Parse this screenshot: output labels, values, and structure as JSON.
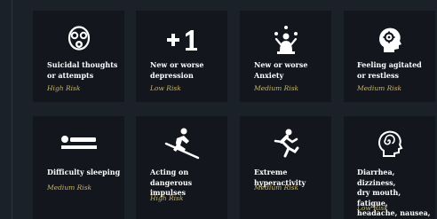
{
  "cards": [
    {
      "title": "Suicidal thoughts\nor attempts",
      "risk": "High Risk",
      "icon": "gas-mask-icon"
    },
    {
      "title": "New or worse\ndepression",
      "risk": "Low Risk",
      "icon": "plus-one-icon"
    },
    {
      "title": "New or worse\nAnxiety",
      "risk": "Medium Risk",
      "icon": "juggling-person-icon"
    },
    {
      "title": "Feeling agitated\nor restless",
      "risk": "Medium Risk",
      "icon": "head-gears-icon"
    },
    {
      "title": "Difficulty sleeping",
      "risk": "Medium Risk",
      "icon": "lying-person-icon"
    },
    {
      "title": "Acting on dangerous\nimpulses",
      "risk": "High Risk",
      "icon": "skier-icon"
    },
    {
      "title": "Extreme\nhyperactivity",
      "risk": "Medium Risk",
      "icon": "running-person-icon"
    },
    {
      "title": "Diarrhea, dizziness,\ndry mouth, fatigue,\nheadache, nausea,",
      "risk": "Low Risk",
      "icon": "dizzy-head-icon"
    }
  ],
  "colors": {
    "background": "#1b2129",
    "card": "#13171d",
    "title": "#ffffff",
    "risk": "#c8b36a"
  }
}
